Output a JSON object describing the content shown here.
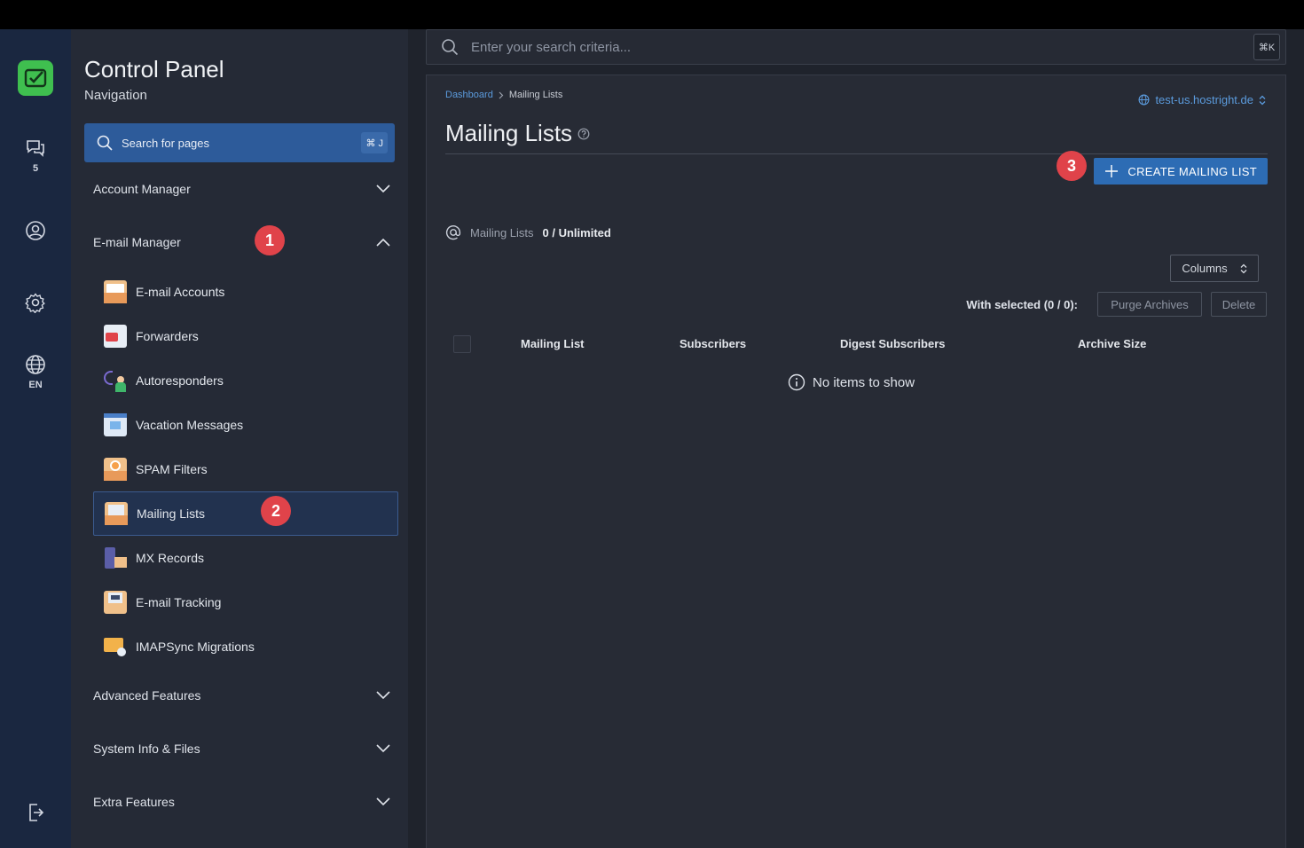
{
  "rail": {
    "chat_count": "5",
    "language": "EN"
  },
  "nav": {
    "title": "Control Panel",
    "subtitle": "Navigation",
    "search_placeholder": "Search for pages",
    "search_shortcut": "⌘ J",
    "sections": {
      "account": "Account Manager",
      "email": "E-mail Manager",
      "advanced": "Advanced Features",
      "system": "System Info & Files",
      "extra": "Extra Features"
    },
    "email_items": [
      {
        "label": "E-mail Accounts",
        "icon": "email-accounts-icon"
      },
      {
        "label": "Forwarders",
        "icon": "forwarders-icon"
      },
      {
        "label": "Autoresponders",
        "icon": "autoresponders-icon"
      },
      {
        "label": "Vacation Messages",
        "icon": "vacation-messages-icon"
      },
      {
        "label": "SPAM Filters",
        "icon": "spam-filters-icon"
      },
      {
        "label": "Mailing Lists",
        "icon": "mailing-lists-icon"
      },
      {
        "label": "MX Records",
        "icon": "mx-records-icon"
      },
      {
        "label": "E-mail Tracking",
        "icon": "email-tracking-icon"
      },
      {
        "label": "IMAPSync Migrations",
        "icon": "imapsync-icon"
      }
    ],
    "active_item": "Mailing Lists"
  },
  "badges": {
    "b1": "1",
    "b2": "2",
    "b3": "3"
  },
  "global_search": {
    "placeholder": "Enter your search criteria...",
    "shortcut": "⌘K"
  },
  "breadcrumb": {
    "home": "Dashboard",
    "current": "Mailing Lists"
  },
  "domain": "test-us.hostright.de",
  "page": {
    "title": "Mailing Lists",
    "create_label": "CREATE MAILING LIST",
    "stat_label": "Mailing Lists",
    "stat_value": "0 / Unlimited",
    "columns_label": "Columns",
    "with_selected": "With selected (0 / 0):",
    "purge_label": "Purge Archives",
    "delete_label": "Delete",
    "table_headers": [
      "Mailing List",
      "Subscribers",
      "Digest Subscribers",
      "Archive Size"
    ],
    "empty_text": "No items to show"
  },
  "colors": {
    "accent": "#2d6cb4",
    "badge": "#e0434a",
    "logo": "#3fbf4f"
  }
}
